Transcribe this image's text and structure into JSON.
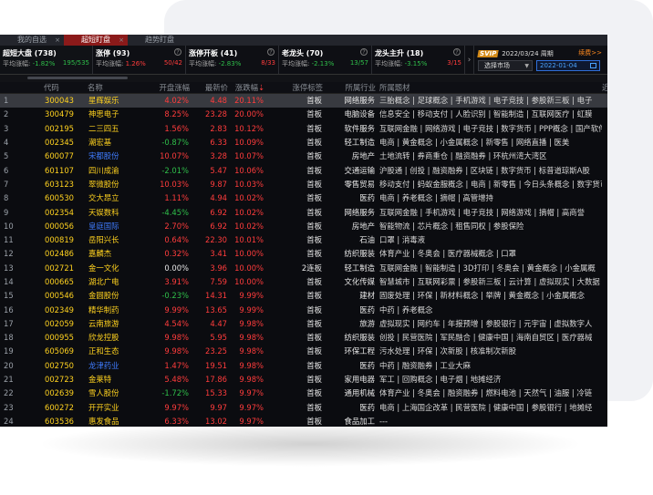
{
  "tabs": [
    {
      "label": "我的自选"
    },
    {
      "label": "超短盯盘"
    },
    {
      "label": "趋势盯盘"
    }
  ],
  "cards": [
    {
      "title": "超短大盘 (738)",
      "avg_label": "平均涨幅:",
      "avg": "-1.82%",
      "ratio": "195/535"
    },
    {
      "title": "涨停 (93)",
      "avg_label": "平均涨幅:",
      "avg": "1.26%",
      "ratio": "50/42"
    },
    {
      "title": "涨停开板 (41)",
      "avg_label": "平均涨幅:",
      "avg": "-2.83%",
      "ratio": "8/33"
    },
    {
      "title": "老龙头 (70)",
      "avg_label": "平均涨幅:",
      "avg": "-2.13%",
      "ratio": "13/57"
    },
    {
      "title": "龙头主升 (18)",
      "avg_label": "平均涨幅:",
      "avg": "-3.15%",
      "ratio": "3/15"
    }
  ],
  "datebox": {
    "badge": "SVIP",
    "title": "2022/03/24 周期",
    "switch": "续费>>",
    "select": "选择市场",
    "date": "2022-01-04"
  },
  "columns": [
    "代码",
    "名称",
    "开盘涨幅",
    "最新价",
    "涨跌幅",
    "涨停标签",
    "所属行业",
    "所属题材",
    "近"
  ],
  "rows": [
    {
      "i": "1",
      "code": "300043",
      "name": "星辉娱乐",
      "nc": "yel",
      "open": "4.02%",
      "oc": "red",
      "price": "4.48",
      "chg": "20.11%",
      "tag": "首板",
      "ind": "网络服务",
      "con": "三胎概念 | 足球概念 | 手机游戏 | 电子竞技 | 参股新三板 | 电子"
    },
    {
      "i": "2",
      "code": "300479",
      "name": "神思电子",
      "nc": "yel",
      "open": "8.25%",
      "oc": "red",
      "price": "23.28",
      "chg": "20.00%",
      "tag": "首板",
      "ind": "电脑设备",
      "con": "信息安全 | 移动支付 | 人脸识别 | 智能制造 | 互联网医疗 | 虹膜"
    },
    {
      "i": "3",
      "code": "002195",
      "name": "二三四五",
      "nc": "yel",
      "open": "1.56%",
      "oc": "red",
      "price": "2.83",
      "chg": "10.12%",
      "tag": "首板",
      "ind": "软件服务",
      "con": "互联网金融 | 网络游戏 | 电子竞技 | 数字货币 | PPP概念 | 国产软件"
    },
    {
      "i": "4",
      "code": "002345",
      "name": "潮宏基",
      "nc": "yel",
      "open": "-0.87%",
      "oc": "grn",
      "price": "6.33",
      "chg": "10.09%",
      "tag": "首板",
      "ind": "轻工制造",
      "con": "电商 | 黄金概念 | 小金属概念 | 新零售 | 网络直播 | 医美"
    },
    {
      "i": "5",
      "code": "600077",
      "name": "宋都股份",
      "nc": "blu",
      "open": "10.07%",
      "oc": "red",
      "price": "3.28",
      "chg": "10.07%",
      "tag": "首板",
      "ind": "房地产",
      "con": "土地流转 | 券商重仓 | 融资融券 | 环杭州湾大湾区"
    },
    {
      "i": "6",
      "code": "601107",
      "name": "四川成渝",
      "nc": "yel",
      "open": "-2.01%",
      "oc": "grn",
      "price": "5.47",
      "chg": "10.06%",
      "tag": "首板",
      "ind": "交通运输",
      "con": "沪股通 | 创投 | 融资融券 | 区块链 | 数字货币 | 标普道琼斯A股"
    },
    {
      "i": "7",
      "code": "603123",
      "name": "翠微股份",
      "nc": "yel",
      "open": "10.03%",
      "oc": "red",
      "price": "9.87",
      "chg": "10.03%",
      "tag": "首板",
      "ind": "零售贸易",
      "con": "移动支付 | 蚂蚁金服概念 | 电商 | 新零售 | 今日头条概念 | 数字货币"
    },
    {
      "i": "8",
      "code": "600530",
      "name": "交大昂立",
      "nc": "yel",
      "open": "1.11%",
      "oc": "red",
      "price": "4.94",
      "chg": "10.02%",
      "tag": "首板",
      "ind": "医药",
      "con": "电商 | 养老概念 | 摘帽 | 高管增持"
    },
    {
      "i": "9",
      "code": "002354",
      "name": "天娱数科",
      "nc": "yel",
      "open": "-4.45%",
      "oc": "grn",
      "price": "6.92",
      "chg": "10.02%",
      "tag": "首板",
      "ind": "网络服务",
      "con": "互联网金融 | 手机游戏 | 电子竞技 | 网络游戏 | 摘帽 | 高商誉"
    },
    {
      "i": "10",
      "code": "000056",
      "name": "皇庭国际",
      "nc": "blu",
      "open": "2.70%",
      "oc": "red",
      "price": "6.92",
      "chg": "10.02%",
      "tag": "首板",
      "ind": "房地产",
      "con": "智能物流 | 芯片概念 | 租售同权 | 参股保险"
    },
    {
      "i": "11",
      "code": "000819",
      "name": "岳阳兴长",
      "nc": "yel",
      "open": "0.64%",
      "oc": "red",
      "price": "22.30",
      "chg": "10.01%",
      "tag": "首板",
      "ind": "石油",
      "con": "口罩 | 消毒液"
    },
    {
      "i": "12",
      "code": "002486",
      "name": "嘉麟杰",
      "nc": "yel",
      "open": "0.32%",
      "oc": "red",
      "price": "3.41",
      "chg": "10.00%",
      "tag": "首板",
      "ind": "纺织服装",
      "con": "体育产业 | 冬奥会 | 医疗器械概念 | 口罩"
    },
    {
      "i": "13",
      "code": "002721",
      "name": "金一文化",
      "nc": "yel",
      "open": "0.00%",
      "oc": "wht",
      "price": "3.96",
      "chg": "10.00%",
      "tag": "2连板",
      "ind": "轻工制造",
      "con": "互联网金融 | 智能制造 | 3D打印 | 冬奥会 | 黄金概念 | 小金属概"
    },
    {
      "i": "14",
      "code": "000665",
      "name": "湖北广电",
      "nc": "yel",
      "open": "3.91%",
      "oc": "red",
      "price": "7.59",
      "chg": "10.00%",
      "tag": "首板",
      "ind": "文化传媒",
      "con": "智慧城市 | 互联网彩票 | 参股新三板 | 云计算 | 虚拟现实 | 大数据"
    },
    {
      "i": "15",
      "code": "000546",
      "name": "金圆股份",
      "nc": "yel",
      "open": "-0.23%",
      "oc": "grn",
      "price": "14.31",
      "chg": "9.99%",
      "tag": "首板",
      "ind": "建材",
      "con": "固废处理 | 环保 | 新材料概念 | 举牌 | 黄金概念 | 小金属概念"
    },
    {
      "i": "16",
      "code": "002349",
      "name": "精华制药",
      "nc": "yel",
      "open": "9.99%",
      "oc": "red",
      "price": "13.65",
      "chg": "9.99%",
      "tag": "首板",
      "ind": "医药",
      "con": "中药 | 养老概念"
    },
    {
      "i": "17",
      "code": "002059",
      "name": "云南旅游",
      "nc": "yel",
      "open": "4.54%",
      "oc": "red",
      "price": "4.47",
      "chg": "9.98%",
      "tag": "首板",
      "ind": "旅游",
      "con": "虚拟现实 | 网约车 | 年报预增 | 参股银行 | 元宇宙 | 虚拟数字人"
    },
    {
      "i": "18",
      "code": "000955",
      "name": "欣龙控股",
      "nc": "yel",
      "open": "9.98%",
      "oc": "red",
      "price": "5.95",
      "chg": "9.98%",
      "tag": "首板",
      "ind": "纺织服装",
      "con": "创投 | 民营医院 | 军民融合 | 健康中国 | 海南自贸区 | 医疗器械"
    },
    {
      "i": "19",
      "code": "605069",
      "name": "正和生态",
      "nc": "yel",
      "open": "9.98%",
      "oc": "red",
      "price": "23.25",
      "chg": "9.98%",
      "tag": "首板",
      "ind": "环保工程",
      "con": "污水处理 | 环保 | 次新股 | 核准制次新股"
    },
    {
      "i": "20",
      "code": "002750",
      "name": "龙津药业",
      "nc": "blu",
      "open": "1.47%",
      "oc": "red",
      "price": "19.51",
      "chg": "9.98%",
      "tag": "首板",
      "ind": "医药",
      "con": "中药 | 融资融券 | 工业大麻"
    },
    {
      "i": "21",
      "code": "002723",
      "name": "金莱特",
      "nc": "yel",
      "open": "5.48%",
      "oc": "red",
      "price": "17.86",
      "chg": "9.98%",
      "tag": "首板",
      "ind": "家用电器",
      "con": "军工 | 回购概念 | 电子烟 | 地摊经济"
    },
    {
      "i": "22",
      "code": "002639",
      "name": "雪人股份",
      "nc": "yel",
      "open": "-1.72%",
      "oc": "grn",
      "price": "15.33",
      "chg": "9.97%",
      "tag": "首板",
      "ind": "通用机械",
      "con": "体育产业 | 冬奥会 | 融资融券 | 燃料电池 | 天然气 | 油服 | 冷链"
    },
    {
      "i": "23",
      "code": "600272",
      "name": "开开实业",
      "nc": "yel",
      "open": "9.97%",
      "oc": "red",
      "price": "9.97",
      "chg": "9.97%",
      "tag": "首板",
      "ind": "医药",
      "con": "电商 | 上海国企改革 | 民营医院 | 健康中国 | 参股银行 | 地摊经"
    },
    {
      "i": "24",
      "code": "603536",
      "name": "惠发食品",
      "nc": "yel",
      "open": "6.33%",
      "oc": "red",
      "price": "13.02",
      "chg": "9.97%",
      "tag": "首板",
      "ind": "食品加工",
      "con": "---"
    }
  ]
}
